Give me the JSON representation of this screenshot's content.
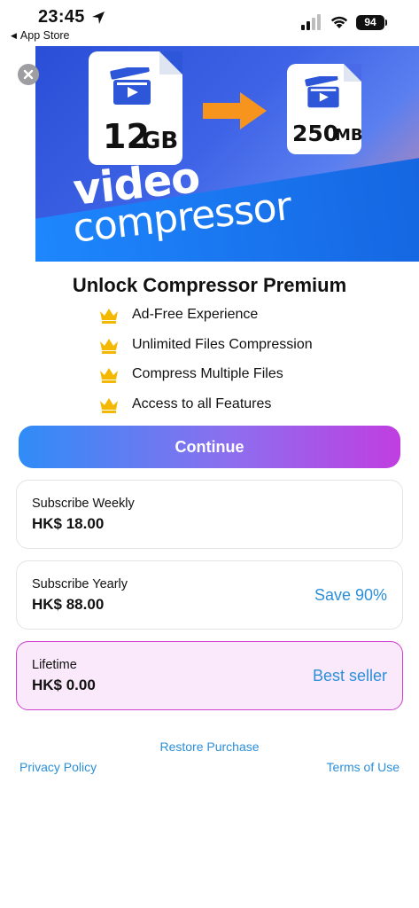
{
  "status_bar": {
    "time": "23:45",
    "back_label": "App Store",
    "battery": "94",
    "icons": [
      "location-arrow-icon",
      "cellular-signal-icon",
      "wifi-icon",
      "battery-icon"
    ]
  },
  "hero": {
    "original_size_number": "12",
    "original_size_unit": "GB",
    "compressed_size_number": "250",
    "compressed_size_unit": "MB",
    "title_line1": "video",
    "title_line2": "compressor",
    "icons": [
      "close-icon",
      "clapperboard-icon",
      "arrow-right-icon"
    ],
    "colors": {
      "arrow": "#f7941d",
      "band": "#1e88ff"
    }
  },
  "headline": "Unlock Compressor Premium",
  "features": [
    {
      "label": "Ad-Free Experience",
      "icon": "crown-icon"
    },
    {
      "label": "Unlimited Files Compression",
      "icon": "crown-icon"
    },
    {
      "label": "Compress Multiple Files",
      "icon": "crown-icon"
    },
    {
      "label": "Access to all Features",
      "icon": "crown-icon"
    }
  ],
  "continue_label": "Continue",
  "plans": [
    {
      "name": "Subscribe Weekly",
      "price": "HK$ 18.00",
      "tag": ""
    },
    {
      "name": "Subscribe Yearly",
      "price": "HK$ 88.00",
      "tag": "Save 90%"
    },
    {
      "name": "Lifetime",
      "price": "HK$ 0.00",
      "tag": "Best seller",
      "selected": true
    }
  ],
  "links": {
    "restore": "Restore Purchase",
    "privacy": "Privacy Policy",
    "terms": "Terms of Use"
  },
  "colors": {
    "accent": "#2b8fd9",
    "selected_border": "#cc3fd0",
    "selected_bg": "#f9e9fb",
    "crown": "#f5b800"
  }
}
